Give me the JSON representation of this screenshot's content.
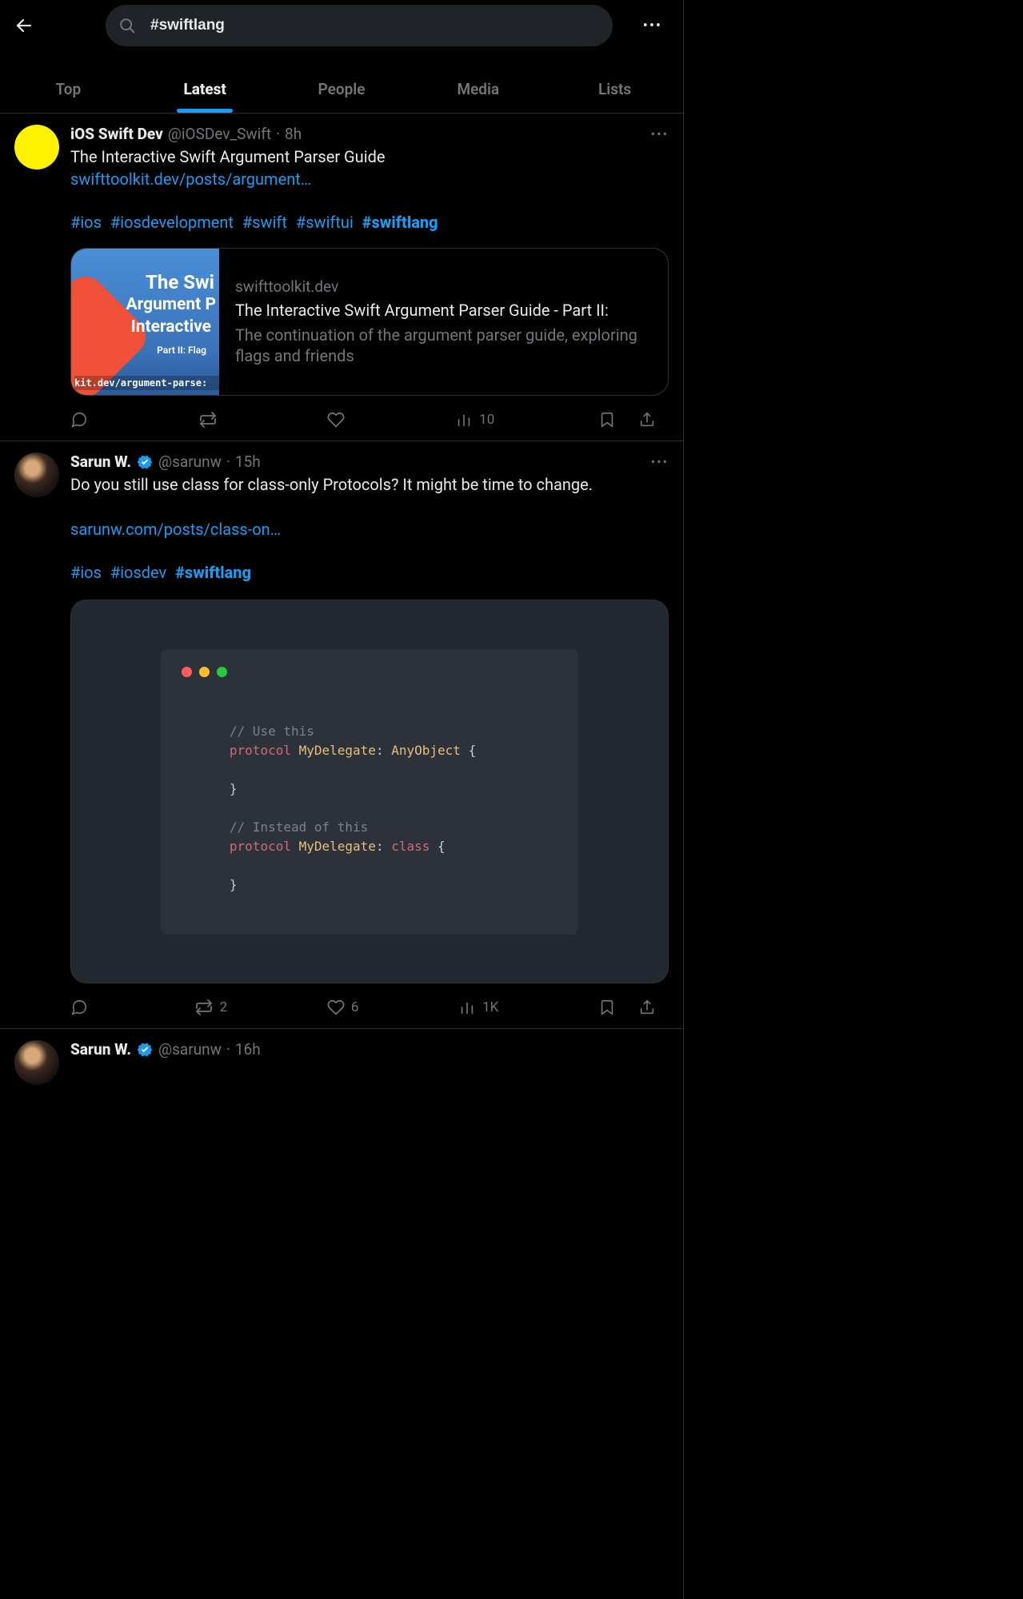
{
  "search": {
    "value": "#swiftlang"
  },
  "tabs": [
    "Top",
    "Latest",
    "People",
    "Media",
    "Lists"
  ],
  "active_tab": 1,
  "tweets": [
    {
      "name": "iOS Swift Dev",
      "handle": "@iOSDev_Swift",
      "time": "8h",
      "verified": false,
      "avatar": "yellow",
      "text": "The Interactive Swift Argument Parser Guide",
      "link": "swifttoolkit.dev/posts/argument…",
      "hashtags": [
        "#ios",
        "#iosdevelopment",
        "#swift",
        "#swiftui"
      ],
      "hashtag_bold": "#swiftlang",
      "card": {
        "thumb": {
          "l1": "The Swi",
          "l2": "Argument P",
          "l3": "Interactive",
          "sub": "Part II: Flag",
          "url": "kit.dev/argument-parse:"
        },
        "domain": "swifttoolkit.dev",
        "title": "The Interactive Swift Argument Parser Guide - Part II:",
        "desc": "The continuation of the argument parser guide, exploring flags and friends"
      },
      "stats": {
        "reply": "",
        "retweet": "",
        "like": "",
        "views": "10"
      }
    },
    {
      "name": "Sarun W.",
      "handle": "@sarunw",
      "time": "15h",
      "verified": true,
      "avatar": "photo",
      "text": "Do you still use class for class-only Protocols? It might be time to change.",
      "link_below": "sarunw.com/posts/class-on…",
      "hashtags": [
        "#ios",
        "#iosdev"
      ],
      "hashtag_bold": "#swiftlang",
      "code": {
        "c1": "// Use this",
        "c2a": "protocol",
        "c2b": "MyDelegate",
        "c2c": "AnyObject",
        "c3": "// Instead of this",
        "c4a": "protocol",
        "c4b": "MyDelegate",
        "c4c": "class"
      },
      "stats": {
        "reply": "",
        "retweet": "2",
        "like": "6",
        "views": "1K"
      }
    },
    {
      "name": "Sarun W.",
      "handle": "@sarunw",
      "time": "16h",
      "verified": true,
      "avatar": "photo"
    }
  ]
}
